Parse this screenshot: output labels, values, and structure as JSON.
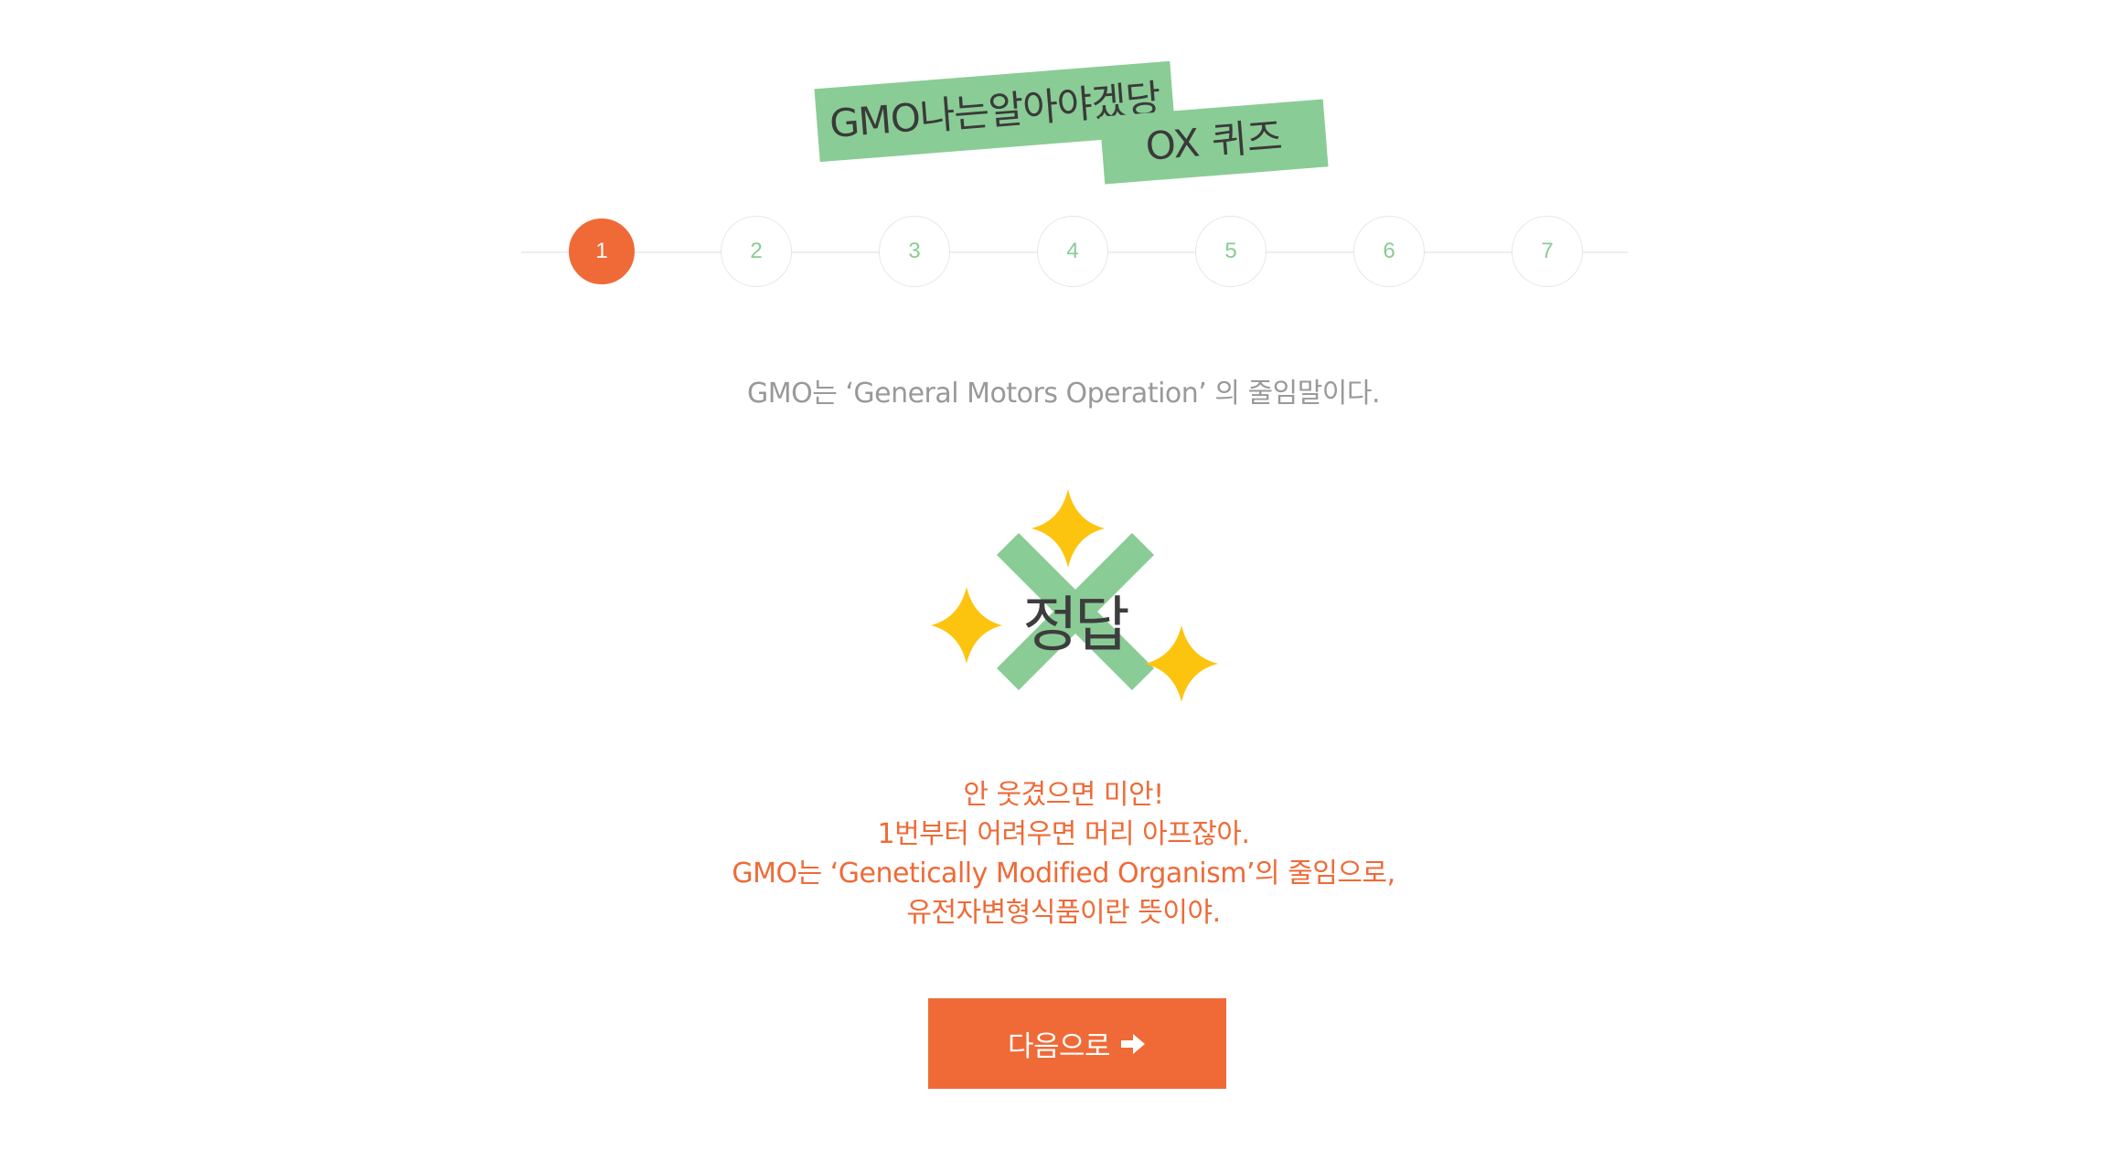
{
  "header": {
    "title_line1": "GMO나는알아야겠당",
    "title_line2": "OX 퀴즈"
  },
  "steps": [
    "1",
    "2",
    "3",
    "4",
    "5",
    "6",
    "7"
  ],
  "current_step": 1,
  "question": {
    "text": "GMO는 ‘General Motors Operation’ 의 줄임말이다."
  },
  "result": {
    "label": "정답",
    "mark_icon": "x-mark-icon",
    "decoration_icon": "sparkle-star-icon"
  },
  "explanation": {
    "lines": [
      "안 웃겼으면 미안!",
      "1번부터 어려우면 머리 아프잖아.",
      "GMO는 ‘Genetically Modified Organism’의 줄임으로,",
      "유전자변형식품이란 뜻이야."
    ]
  },
  "next_button": {
    "label": "다음으로",
    "icon": "arrow-right-icon"
  },
  "colors": {
    "accent": "#ef6a37",
    "green": "#8acc95",
    "star": "#fdc40f",
    "muted_text": "#999999"
  }
}
